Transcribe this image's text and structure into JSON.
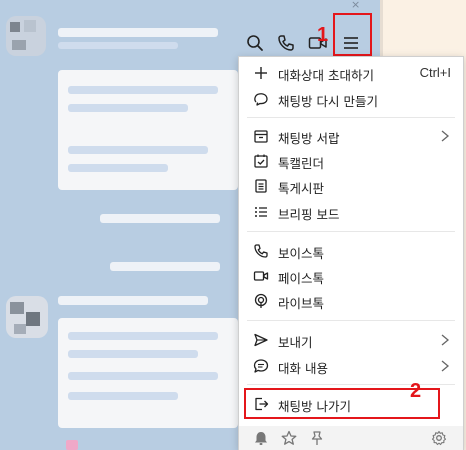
{
  "menu": {
    "items": [
      {
        "label": "대화상대 초대하기",
        "shortcut": "Ctrl+I",
        "icon": "plus-icon"
      },
      {
        "label": "채팅방 다시 만들기",
        "icon": "chat-refresh-icon"
      },
      {
        "label": "채팅방 서랍",
        "icon": "drawer-icon",
        "submenu": true
      },
      {
        "label": "톡캘린더",
        "icon": "calendar-check-icon"
      },
      {
        "label": "톡게시판",
        "icon": "board-icon"
      },
      {
        "label": "브리핑 보드",
        "icon": "list-icon"
      },
      {
        "label": "보이스톡",
        "icon": "voice-call-icon"
      },
      {
        "label": "페이스톡",
        "icon": "video-call-icon"
      },
      {
        "label": "라이브톡",
        "icon": "live-icon"
      },
      {
        "label": "보내기",
        "icon": "send-icon",
        "submenu": true
      },
      {
        "label": "대화 내용",
        "icon": "chat-bubble-icon",
        "submenu": true
      },
      {
        "label": "채팅방 나가기",
        "icon": "exit-icon"
      }
    ],
    "footer_icons": [
      "bell-icon",
      "star-icon",
      "pin-icon",
      "settings-icon"
    ]
  },
  "header": {
    "icons": [
      "search-icon",
      "phone-icon",
      "video-icon",
      "menu-icon"
    ],
    "close_glyph": "×"
  },
  "callouts": [
    {
      "number": "1"
    },
    {
      "number": "2"
    }
  ],
  "colors": {
    "callout": "#e4161b",
    "chat_background": "#b8cde2",
    "menu_background": "#ffffff"
  }
}
